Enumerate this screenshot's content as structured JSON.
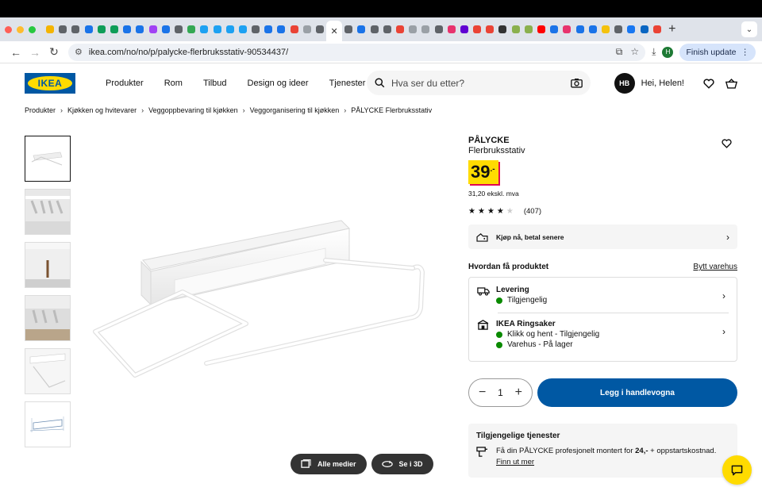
{
  "browser": {
    "tab_favicon_colors": [
      "#f4b400",
      "#5f6368",
      "#5f6368",
      "#1a73e8",
      "#0f9d58",
      "#0f9d58",
      "#1a73e8",
      "#1a73e8",
      "#a142f4",
      "#1a73e8",
      "#5f6368",
      "#34a853",
      "#1da1f2",
      "#1da1f2",
      "#1da1f2",
      "#1da1f2",
      "#5f6368",
      "#1a73e8",
      "#1a73e8",
      "#ea4335",
      "#9aa0a6",
      "#5f6368"
    ],
    "tab_favicon_colors_right": [
      "#5f6368",
      "#1a73e8",
      "#5f6368",
      "#5f6368",
      "#ea4335",
      "#9aa0a6",
      "#9aa0a6",
      "#5f6368",
      "#e8336d",
      "#6001d2",
      "#ea4335",
      "#ea4335",
      "#333333",
      "#8ab04d",
      "#8ab04d",
      "#ff0000",
      "#1a73e8",
      "#e8336d",
      "#1a73e8",
      "#1a73e8",
      "#f4c20d",
      "#5f6368",
      "#1877f2",
      "#0a66c2",
      "#ea4335"
    ],
    "url": "ikea.com/no/no/p/palycke-flerbruksstativ-90534437/",
    "finish_update": "Finish update",
    "profile_initial": "H"
  },
  "header": {
    "logo_text": "IKEA",
    "nav": [
      "Produkter",
      "Rom",
      "Tilbud",
      "Design og ideer",
      "Tjenester"
    ],
    "search_placeholder": "Hva ser du etter?",
    "user_initials": "HB",
    "greeting": "Hei, Helen!"
  },
  "breadcrumb": [
    "Produkter",
    "Kjøkken og hvitevarer",
    "Veggoppbevaring til kjøkken",
    "Veggorganisering til kjøkken",
    "PÅLYCKE Flerbruksstativ"
  ],
  "product": {
    "name": "PÅLYCKE",
    "description": "Flerbruksstativ",
    "price": "39",
    "price_suffix": ".-",
    "price_ex_vat": "31,20 ekskl. mva",
    "stars": 4,
    "rating_count": "(407)",
    "klarna_text": "Kjøp nå, betal senere",
    "how_title": "Hvordan få produktet",
    "change_store": "Bytt varehus",
    "delivery": {
      "title": "Levering",
      "status": "Tilgjengelig"
    },
    "store": {
      "title": "IKEA Ringsaker",
      "click_collect": "Klikk og hent - Tilgjengelig",
      "store_stock": "Varehus - På lager"
    },
    "quantity": "1",
    "add_to_cart": "Legg i handlevogna",
    "services_title": "Tilgjengelige tjenester",
    "services_text_1": "Få din PÅLYCKE profesjonelt montert for",
    "services_price": "24,-",
    "services_text_2": "+ oppstartskostnad.",
    "services_link": "Finn ut mer"
  },
  "media": {
    "all_media": "Alle medier",
    "view_3d": "Se i 3D"
  },
  "colors": {
    "ikea_blue": "#0058a3",
    "ikea_yellow": "#ffdb00",
    "price_shadow": "#e00751",
    "available_green": "#0a8a00"
  }
}
